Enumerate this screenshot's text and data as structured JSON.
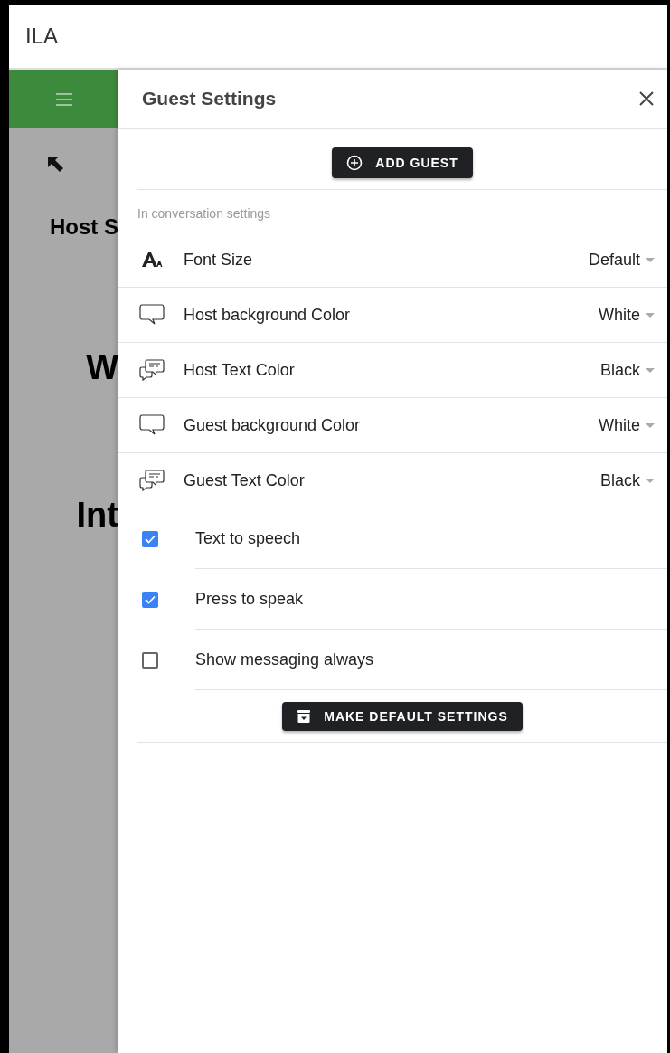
{
  "app_bar": {
    "title": "ILA"
  },
  "background_page": {
    "texts": [
      {
        "text": "Host S",
        "kind": "heading"
      },
      {
        "text": "W",
        "kind": "large"
      },
      {
        "text": "Int",
        "kind": "large"
      }
    ]
  },
  "drawer": {
    "title": "Guest Settings",
    "add_button": "ADD GUEST",
    "subheader": "In conversation settings",
    "selects": [
      {
        "kind": "font",
        "label": "Font Size",
        "value": "Default"
      },
      {
        "kind": "bubble",
        "label": "Host background Color",
        "value": "White"
      },
      {
        "kind": "message",
        "label": "Host Text Color",
        "value": "Black"
      },
      {
        "kind": "bubble",
        "label": "Guest background Color",
        "value": "White"
      },
      {
        "kind": "message",
        "label": "Guest Text Color",
        "value": "Black"
      }
    ],
    "checkboxes": [
      {
        "label": "Text to speech",
        "checked": true
      },
      {
        "label": "Press to speak",
        "checked": true
      },
      {
        "label": "Show messaging always",
        "checked": false
      }
    ],
    "default_button": "MAKE DEFAULT SETTINGS"
  }
}
